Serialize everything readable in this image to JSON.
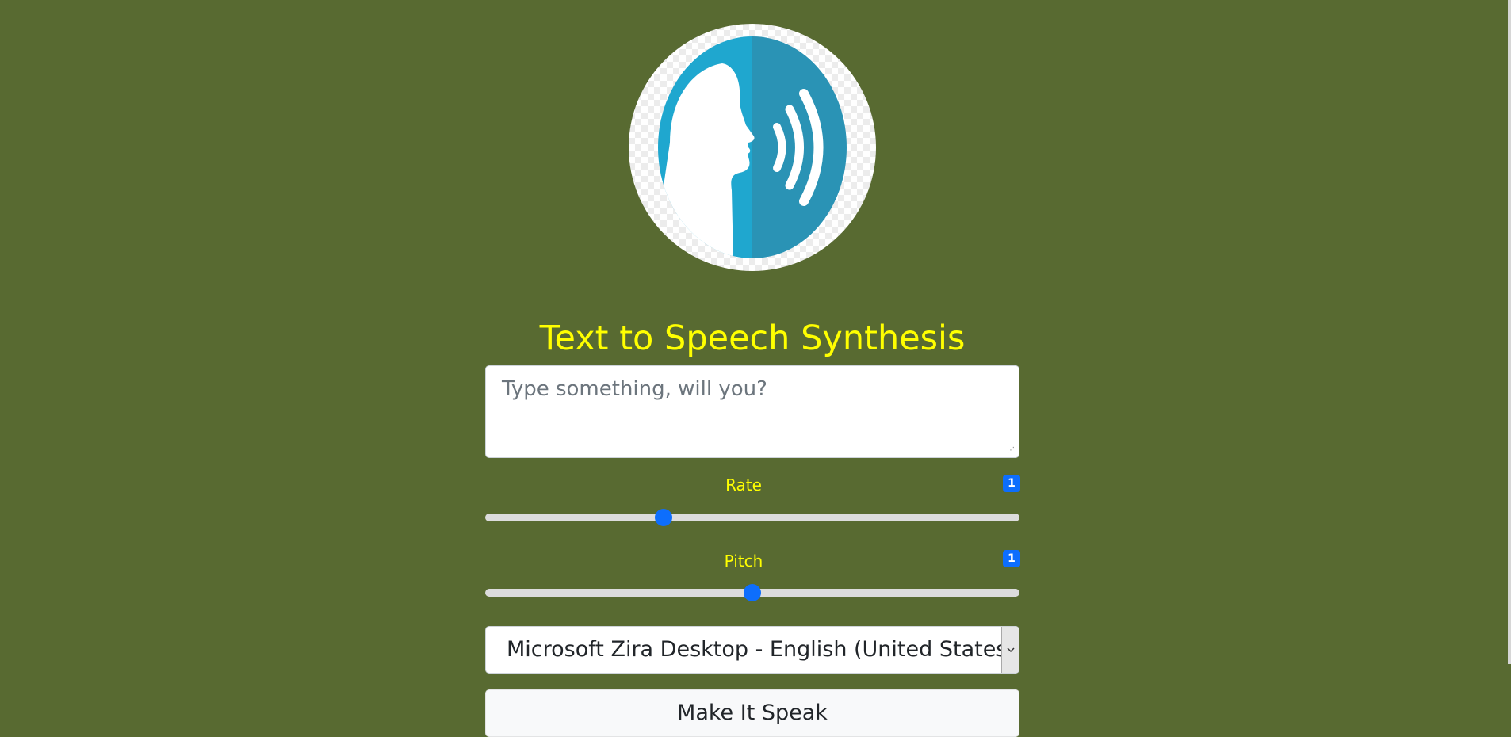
{
  "app": {
    "title": "Text to Speech Synthesis",
    "logo_icon": "speaking-head-icon"
  },
  "input": {
    "placeholder": "Type something, will you?",
    "value": ""
  },
  "rate": {
    "label": "Rate",
    "value": "1",
    "min": 0.5,
    "max": 2,
    "current": 1
  },
  "pitch": {
    "label": "Pitch",
    "value": "1",
    "min": 0,
    "max": 2,
    "current": 1
  },
  "voice": {
    "selected": "Microsoft Zira Desktop - English (United States)(en-US)"
  },
  "actions": {
    "speak_label": "Make It Speak"
  },
  "colors": {
    "background": "#586a31",
    "accent_text": "#ffff00",
    "badge": "#0d6efd",
    "logo_left": "#1fa7cf",
    "logo_right": "#2a93b5"
  }
}
